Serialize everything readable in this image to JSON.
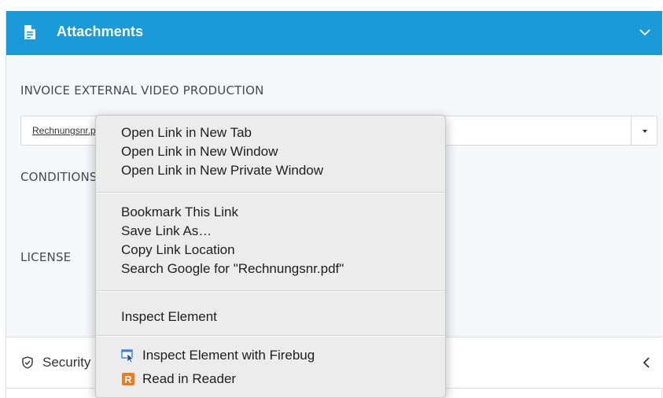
{
  "header": {
    "title": "Attachments"
  },
  "fields": {
    "invoice_label": "INVOICE EXTERNAL VIDEO PRODUCTION",
    "invoice_value": "Rechnungsnr.pdf",
    "conditions_label": "CONDITIONS",
    "license_label": "LICENSE"
  },
  "security": {
    "label": "Security"
  },
  "context_menu": {
    "groups": [
      [
        "Open Link in New Tab",
        "Open Link in New Window",
        "Open Link in New Private Window"
      ],
      [
        "Bookmark This Link",
        "Save Link As…",
        "Copy Link Location",
        "Search Google for \"Rechnungsnr.pdf\""
      ],
      [
        "Inspect Element"
      ],
      [
        "Inspect Element with Firebug",
        "Read in Reader"
      ]
    ]
  },
  "colors": {
    "header_bg": "#1a9ad6",
    "panel_bg": "#f4f8fb",
    "menu_bg": "#ececec",
    "reader_icon": "#f07a1c",
    "firebug_icon": "#3a7fd6"
  },
  "icons": {
    "header": "document-icon",
    "header_toggle": "chevron-down-icon",
    "security": "shield-icon",
    "security_toggle": "chevron-left-icon",
    "firebug": "firebug-inspect-icon",
    "reader": "reader-icon"
  }
}
